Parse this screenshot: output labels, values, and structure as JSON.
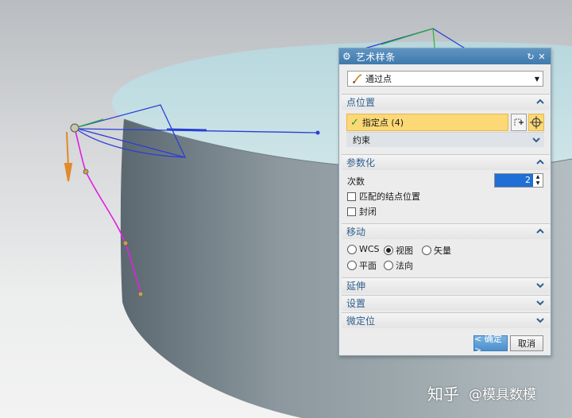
{
  "dialog": {
    "title": "艺术样条",
    "type_select": "通过点",
    "sections": {
      "point_position": {
        "title": "点位置",
        "specify_point": "指定点 (4)",
        "constraint": "约束"
      },
      "parameterization": {
        "title": "参数化",
        "degree_label": "次数",
        "degree_value": "2",
        "match_knots": "匹配的结点位置",
        "closed": "封闭"
      },
      "move": {
        "title": "移动",
        "options": [
          "WCS",
          "视图",
          "矢量",
          "平面",
          "法向"
        ],
        "selected": "视图"
      },
      "extend": {
        "title": "延伸"
      },
      "settings": {
        "title": "设置"
      },
      "fine_position": {
        "title": "微定位"
      }
    },
    "buttons": {
      "ok": "< 确定 >",
      "cancel": "取消"
    }
  },
  "watermark": {
    "brand": "知乎",
    "handle": "@模具数模"
  },
  "colors": {
    "accent": "#3f79ab",
    "section_title": "#2f5f8f",
    "selected_row": "#fcd877",
    "spline": "#e020e0",
    "pole_polygon": "#2a3fd6"
  }
}
